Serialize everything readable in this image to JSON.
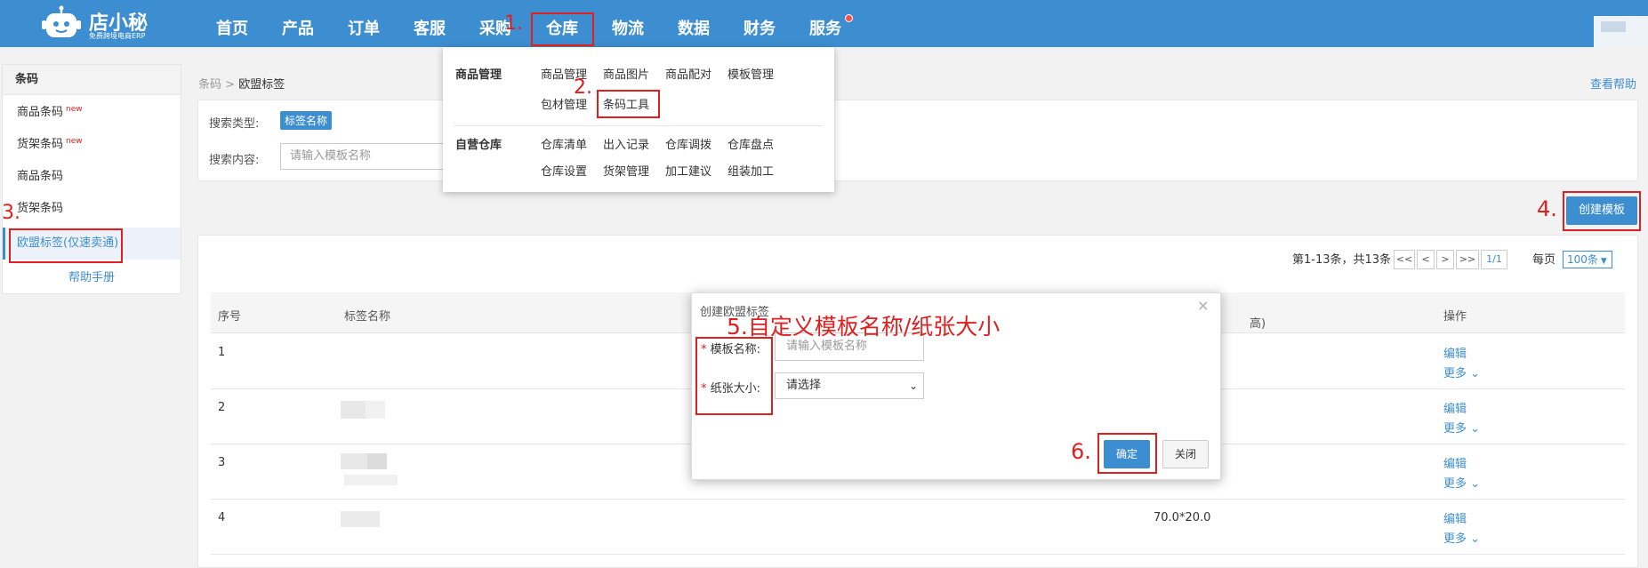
{
  "app": {
    "logo_name": "店小秘",
    "logo_sub": "免费跨境电商ERP"
  },
  "nav": {
    "items": [
      "首页",
      "产品",
      "订单",
      "客服",
      "采购",
      "仓库",
      "物流",
      "数据",
      "财务",
      "服务"
    ]
  },
  "dropdown": {
    "group1": {
      "title": "商品管理",
      "row1": [
        "商品管理",
        "商品图片",
        "商品配对",
        "模板管理"
      ],
      "row2": [
        "包材管理",
        "条码工具"
      ]
    },
    "group2": {
      "title": "自营仓库",
      "row1": [
        "仓库清单",
        "出入记录",
        "仓库调拨",
        "仓库盘点"
      ],
      "row2": [
        "仓库设置",
        "货架管理",
        "加工建议",
        "组装加工"
      ]
    }
  },
  "sidebar": {
    "title": "条码",
    "items": [
      {
        "label": "商品条码",
        "tag": "new"
      },
      {
        "label": "货架条码",
        "tag": "new"
      },
      {
        "label": "商品条码",
        "tag": ""
      },
      {
        "label": "货架条码",
        "tag": ""
      },
      {
        "label": "欧盟标签(仅速卖通)",
        "tag": ""
      }
    ],
    "help": "帮助手册"
  },
  "breadcrumb": {
    "parent": "条码",
    "sep": " > ",
    "current": "欧盟标签"
  },
  "view_help": "查看帮助",
  "search": {
    "type_label": "搜索类型:",
    "type_value": "标签名称",
    "content_label": "搜索内容:",
    "placeholder": "请输入模板名称"
  },
  "create_button": "创建模板",
  "pager": {
    "summary": "第1-13条，共13条",
    "first": "<<",
    "prev": "<",
    "next": ">",
    "last": ">>",
    "page": "1/1",
    "per_page_label": "每页",
    "per_page": "100条"
  },
  "table": {
    "headers": {
      "index": "序号",
      "name": "标签名称",
      "size_partial": "高)",
      "ops": "操作"
    },
    "rows": [
      {
        "index": "1",
        "size": "",
        "edit": "编辑",
        "more": "更多"
      },
      {
        "index": "2",
        "size": "",
        "edit": "编辑",
        "more": "更多"
      },
      {
        "index": "3",
        "size": "",
        "edit": "编辑",
        "more": "更多"
      },
      {
        "index": "4",
        "size": "70.0*20.0",
        "edit": "编辑",
        "more": "更多"
      }
    ]
  },
  "modal": {
    "title": "创建欧盟标签",
    "close": "×",
    "name_label": "模板名称:",
    "name_placeholder": "请输入模板名称",
    "paper_label": "纸张大小:",
    "paper_value": "请选择",
    "ok": "确定",
    "cancel": "关闭"
  },
  "annotations": {
    "a1": "1.",
    "a2": "2.",
    "a3": "3.",
    "a4": "4.",
    "a5": "5.自定义模板名称/纸张大小",
    "a6": "6."
  },
  "colors": {
    "primary": "#3d8ed1",
    "annotation": "#e02020"
  }
}
